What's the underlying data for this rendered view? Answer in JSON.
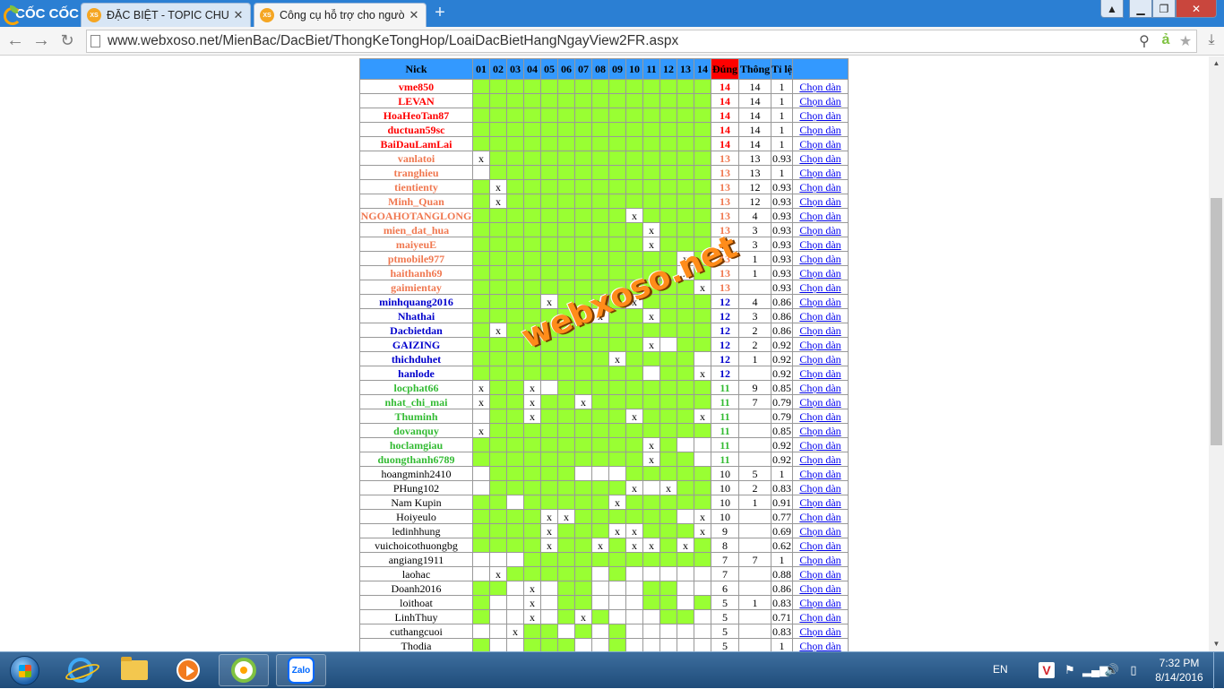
{
  "browser": {
    "brand": "CỐC CỐC",
    "tabs": [
      {
        "label": "ĐẶC BIỆT - TOPIC CHUYÊN",
        "favicon": "XS",
        "active": false
      },
      {
        "label": "Công cụ hỗ trợ cho người",
        "favicon": "XS",
        "active": true
      }
    ],
    "url": "www.webxoso.net/MienBac/DacBiet/ThongKeTongHop/LoaiDacBietHangNgayView2FR.aspx"
  },
  "colors": {
    "header_bg": "#3399ff",
    "header_dung_bg": "#ff0000",
    "cell_hit": "#99ff33",
    "cell_miss": "#ffffff",
    "tier14": "#ff0000",
    "tier13": "#f07850",
    "tier12": "#0000cc",
    "tier11": "#33bb33",
    "plain": "#000000",
    "link": "#0000ee",
    "watermark": "#ff8c1a"
  },
  "table": {
    "headers": {
      "nick": "Nick",
      "days": [
        "01",
        "02",
        "03",
        "04",
        "05",
        "06",
        "07",
        "08",
        "09",
        "10",
        "11",
        "12",
        "13",
        "14"
      ],
      "dung": "Đúng",
      "thong": "Thông",
      "tile": "Tỉ lệ",
      "action": ""
    },
    "action_label": "Chọn dàn",
    "rows": [
      {
        "nick": "vme850",
        "tier": "14",
        "cells": "gggggggggggggg",
        "dung": "14",
        "thong": "14",
        "tile": "1"
      },
      {
        "nick": "LEVAN",
        "tier": "14",
        "cells": "gggggggggggggg",
        "dung": "14",
        "thong": "14",
        "tile": "1"
      },
      {
        "nick": "HoaHeoTan87",
        "tier": "14",
        "cells": "gggggggggggggg",
        "dung": "14",
        "thong": "14",
        "tile": "1"
      },
      {
        "nick": "ductuan59sc",
        "tier": "14",
        "cells": "gggggggggggggg",
        "dung": "14",
        "thong": "14",
        "tile": "1"
      },
      {
        "nick": "BaiDauLamLai",
        "tier": "14",
        "cells": "gggggggggggggg",
        "dung": "14",
        "thong": "14",
        "tile": "1"
      },
      {
        "nick": "vanlatoi",
        "tier": "13",
        "cells": "xggggggggggggg",
        "dung": "13",
        "thong": "13",
        "tile": "0.93"
      },
      {
        "nick": "tranghieu",
        "tier": "13",
        "cells": "wggggggggggggg",
        "dung": "13",
        "thong": "13",
        "tile": "1"
      },
      {
        "nick": "tientienty",
        "tier": "13",
        "cells": "gxgggggggggggg",
        "dung": "13",
        "thong": "12",
        "tile": "0.93"
      },
      {
        "nick": "Minh_Quan",
        "tier": "13",
        "cells": "gxgggggggggggg",
        "dung": "13",
        "thong": "12",
        "tile": "0.93"
      },
      {
        "nick": "NGOAHOTANGLONG",
        "tier": "13",
        "cells": "gggggggggxgggg",
        "dung": "13",
        "thong": "4",
        "tile": "0.93"
      },
      {
        "nick": "mien_dat_hua",
        "tier": "13",
        "cells": "ggggggggggxggg",
        "dung": "13",
        "thong": "3",
        "tile": "0.93"
      },
      {
        "nick": "maiyeuE",
        "tier": "13",
        "cells": "ggggggggggxggg",
        "dung": "13",
        "thong": "3",
        "tile": "0.93"
      },
      {
        "nick": "ptmobile977",
        "tier": "13",
        "cells": "ggggggggggggxg",
        "dung": "13",
        "thong": "1",
        "tile": "0.93"
      },
      {
        "nick": "haithanh69",
        "tier": "13",
        "cells": "ggggggggggggxg",
        "dung": "13",
        "thong": "1",
        "tile": "0.93"
      },
      {
        "nick": "gaimientay",
        "tier": "13",
        "cells": "gggggggggggggx",
        "dung": "13",
        "thong": "",
        "tile": "0.93"
      },
      {
        "nick": "minhquang2016",
        "tier": "12",
        "cells": "ggggxggggxgggg",
        "dung": "12",
        "thong": "4",
        "tile": "0.86"
      },
      {
        "nick": "Nhathai",
        "tier": "12",
        "cells": "gggggggxggxggg",
        "dung": "12",
        "thong": "3",
        "tile": "0.86"
      },
      {
        "nick": "Dacbietdan",
        "tier": "12",
        "cells": "gxgggggggggggg",
        "dung": "12",
        "thong": "2",
        "tile": "0.86"
      },
      {
        "nick": "GAIZING",
        "tier": "12",
        "cells": "ggggggggggxwgg",
        "dung": "12",
        "thong": "2",
        "tile": "0.92"
      },
      {
        "nick": "thichduhet",
        "tier": "12",
        "cells": "ggggggggxggggw",
        "dung": "12",
        "thong": "1",
        "tile": "0.92"
      },
      {
        "nick": "hanlode",
        "tier": "12",
        "cells": "ggggggggggwggx",
        "dung": "12",
        "thong": "",
        "tile": "0.92"
      },
      {
        "nick": "locphat66",
        "tier": "11",
        "cells": "xggxwggggggggg",
        "dung": "11",
        "thong": "9",
        "tile": "0.85"
      },
      {
        "nick": "nhat_chi_mai",
        "tier": "11",
        "cells": "xggxggxggggggg",
        "dung": "11",
        "thong": "7",
        "tile": "0.79"
      },
      {
        "nick": "Thuminh",
        "tier": "11",
        "cells": "wggxgggggxgggx",
        "dung": "11",
        "thong": "",
        "tile": "0.79"
      },
      {
        "nick": "dovanquy",
        "tier": "11",
        "cells": "xggggggggggggg",
        "dung": "11",
        "thong": "",
        "tile": "0.85"
      },
      {
        "nick": "hoclamgiau",
        "tier": "11",
        "cells": "ggggggggggxgww",
        "dung": "11",
        "thong": "",
        "tile": "0.92"
      },
      {
        "nick": "duongthanh6789",
        "tier": "11",
        "cells": "ggggggggggxggw",
        "dung": "11",
        "thong": "",
        "tile": "0.92"
      },
      {
        "nick": "hoangminh2410",
        "tier": "plain",
        "cells": "wgggggwwwggggg",
        "dung": "10",
        "thong": "5",
        "tile": "1"
      },
      {
        "nick": "PHung102",
        "tier": "plain",
        "cells": "wggggggggxwxgg",
        "dung": "10",
        "thong": "2",
        "tile": "0.83"
      },
      {
        "nick": "Nam Kupin",
        "tier": "plain",
        "cells": "ggwgggggxggggg",
        "dung": "10",
        "thong": "1",
        "tile": "0.91"
      },
      {
        "nick": "Hoiyeulo",
        "tier": "plain",
        "cells": "ggggxxggggggwx",
        "dung": "10",
        "thong": "",
        "tile": "0.77"
      },
      {
        "nick": "ledinhhung",
        "tier": "plain",
        "cells": "ggggxgggxxgggx",
        "dung": "9",
        "thong": "",
        "tile": "0.69"
      },
      {
        "nick": "vuichoicothuongbg",
        "tier": "plain",
        "cells": "ggggxggxgxxgxg",
        "dung": "8",
        "thong": "",
        "tile": "0.62"
      },
      {
        "nick": "angiang1911",
        "tier": "plain",
        "cells": "wwwggggggggggg",
        "dung": "7",
        "thong": "7",
        "tile": "1"
      },
      {
        "nick": "laohac",
        "tier": "plain",
        "cells": "wxgggggwgwwwww",
        "dung": "7",
        "thong": "",
        "tile": "0.88"
      },
      {
        "nick": "Doanh2016",
        "tier": "plain",
        "cells": "ggwxwggwwwggww",
        "dung": "6",
        "thong": "",
        "tile": "0.86"
      },
      {
        "nick": "loithoat",
        "tier": "plain",
        "cells": "gwwxwggwwwggwg",
        "dung": "5",
        "thong": "1",
        "tile": "0.83"
      },
      {
        "nick": "LinhThuy",
        "tier": "plain",
        "cells": "gwwxwgxgwwwggw",
        "dung": "5",
        "thong": "",
        "tile": "0.71"
      },
      {
        "nick": "cuthangcuoi",
        "tier": "plain",
        "cells": "wwxggwgwgwwwww",
        "dung": "5",
        "thong": "",
        "tile": "0.83"
      },
      {
        "nick": "Thodia",
        "tier": "plain",
        "cells": "gwwgggwwgwwwww",
        "dung": "5",
        "thong": "",
        "tile": "1"
      }
    ]
  },
  "watermark": "webxoso.net",
  "taskbar": {
    "apps": [
      "internet-explorer-icon",
      "file-explorer-icon",
      "media-player-icon",
      "coccoc-browser-icon",
      "zalo-icon"
    ],
    "zalo_label": "Zalo",
    "lang": "EN",
    "time": "7:32 PM",
    "date": "8/14/2016"
  }
}
